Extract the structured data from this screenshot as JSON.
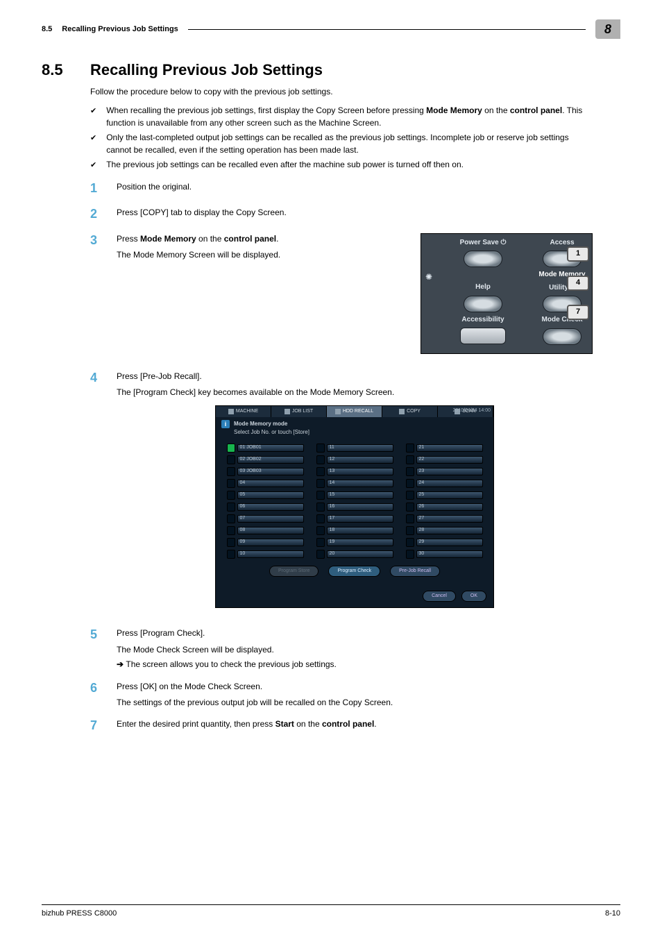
{
  "header": {
    "section_no": "8.5",
    "section_title": "Recalling Previous Job Settings",
    "chapter_no": "8"
  },
  "h1": {
    "num": "8.5",
    "title": "Recalling Previous Job Settings"
  },
  "intro": "Follow the procedure below to copy with the previous job settings.",
  "bullets": [
    "When recalling the previous job settings, first display the Copy Screen before pressing Mode Memory on the control panel. This function is unavailable from any other screen such as the Machine Screen.",
    "Only the last-completed output job settings can be recalled as the previous job settings. Incomplete job or reserve job settings cannot be recalled, even if the setting operation has been made last.",
    "The previous job settings can be recalled even after the machine sub power is turned off then on."
  ],
  "steps": {
    "s1": {
      "n": "1",
      "t": "Position the original."
    },
    "s2": {
      "n": "2",
      "t": "Press [COPY] tab to display the Copy Screen."
    },
    "s3": {
      "n": "3",
      "t1": "Press Mode Memory on the control panel.",
      "t2": "The Mode Memory Screen will be displayed."
    },
    "s4": {
      "n": "4",
      "t1": "Press [Pre-Job Recall].",
      "t2": "The [Program Check] key becomes available on the Mode Memory Screen."
    },
    "s5": {
      "n": "5",
      "t1": "Press [Program Check].",
      "t2": "The Mode Check Screen will be displayed.",
      "t3": "The screen allows you to check the previous job settings."
    },
    "s6": {
      "n": "6",
      "t1": "Press [OK] on the Mode Check Screen.",
      "t2": "The settings of the previous output job will be recalled on the Copy Screen."
    },
    "s7": {
      "n": "7",
      "t1": "Enter the desired print quantity, then press Start on the control panel."
    }
  },
  "panel1": {
    "power_save": "Power Save",
    "access": "Access",
    "mode_memory": "Mode Memory",
    "help": "Help",
    "utility": "Utility/C",
    "accessibility": "Accessibility",
    "mode_check": "Mode Check",
    "keys": {
      "k1": "1",
      "k4": "4",
      "k7": "7"
    }
  },
  "panel2": {
    "tabs": [
      "MACHINE",
      "JOB LIST",
      "HDD RECALL",
      "COPY",
      "SCAN"
    ],
    "timestamp": "2010/04/04 14:00",
    "header_title": "Mode Memory mode",
    "header_sub": "Select Job No. or touch [Store]",
    "col1": [
      "01  JOB01",
      "02  JOB02",
      "03  JOB03",
      "04",
      "05",
      "06",
      "07",
      "08",
      "09",
      "10"
    ],
    "col2": [
      "11",
      "12",
      "13",
      "14",
      "15",
      "16",
      "17",
      "18",
      "19",
      "20"
    ],
    "col3": [
      "21",
      "22",
      "23",
      "24",
      "25",
      "26",
      "27",
      "28",
      "29",
      "30"
    ],
    "footer": {
      "store": "Program Store",
      "check": "Program Check",
      "recall": "Pre-Job Recall",
      "cancel": "Cancel",
      "ok": "OK"
    }
  },
  "footer": {
    "product": "bizhub PRESS C8000",
    "page": "8-10"
  }
}
